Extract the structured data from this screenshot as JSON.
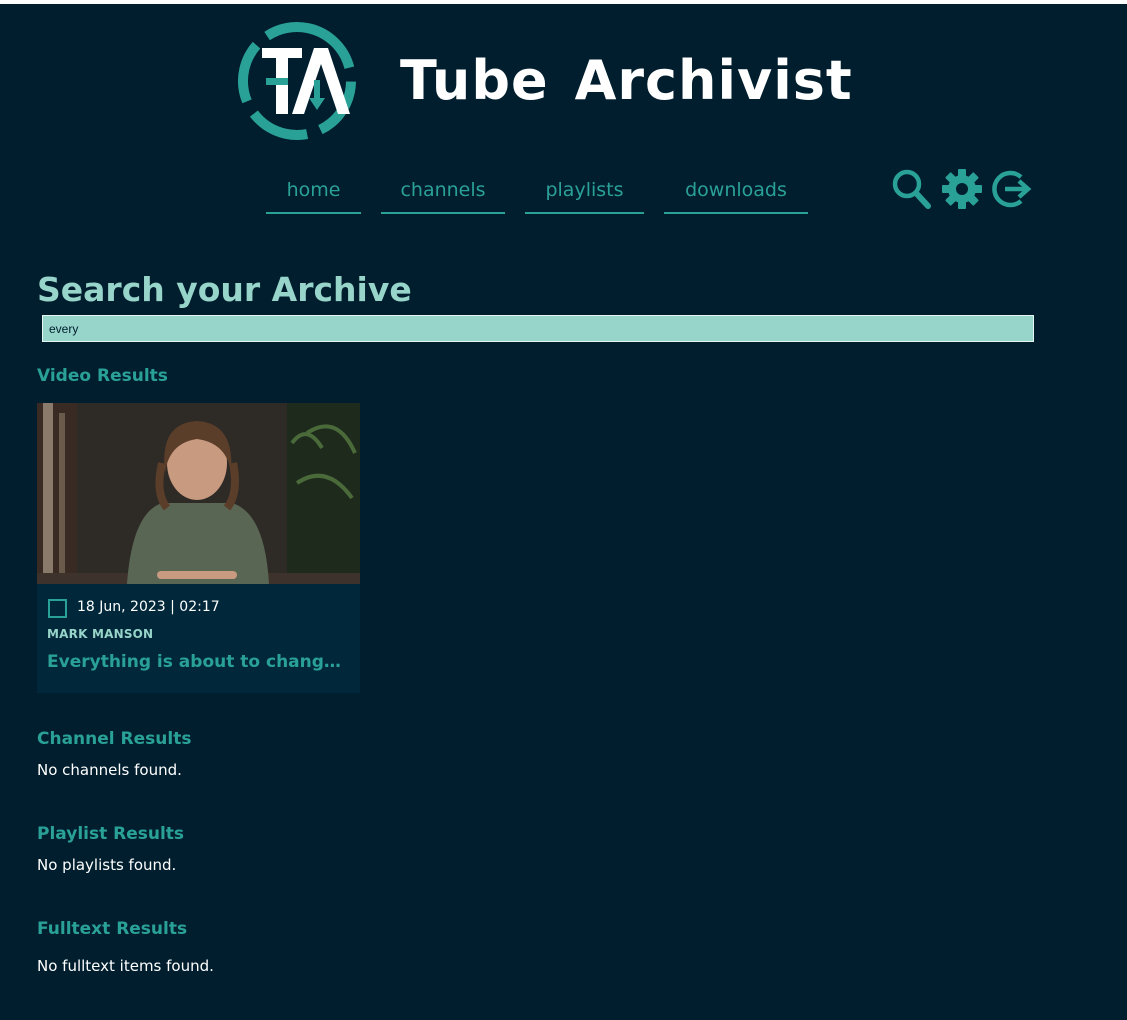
{
  "brand": {
    "logo_letters": "TA",
    "title_word1": "Tube",
    "title_word2": "Archivist"
  },
  "nav": {
    "items": [
      {
        "label": "home"
      },
      {
        "label": "channels"
      },
      {
        "label": "playlists"
      },
      {
        "label": "downloads"
      }
    ],
    "icons": [
      "search-icon",
      "gear-icon",
      "logout-icon"
    ]
  },
  "search": {
    "title": "Search your Archive",
    "value": "every"
  },
  "results": {
    "video": {
      "title": "Video Results",
      "items": [
        {
          "date": "18 Jun, 2023 | 02:17",
          "channel": "MARK MANSON",
          "title": "Everything is about to change..."
        }
      ]
    },
    "channel": {
      "title": "Channel Results",
      "empty": "No channels found."
    },
    "playlist": {
      "title": "Playlist Results",
      "empty": "No playlists found."
    },
    "fulltext": {
      "title": "Fulltext Results",
      "empty": "No fulltext items found."
    }
  },
  "colors": {
    "background": "#001e2e",
    "accent": "#2aa197",
    "accent_light": "#97d4c9",
    "card": "#00283a",
    "text": "#ffffff"
  }
}
